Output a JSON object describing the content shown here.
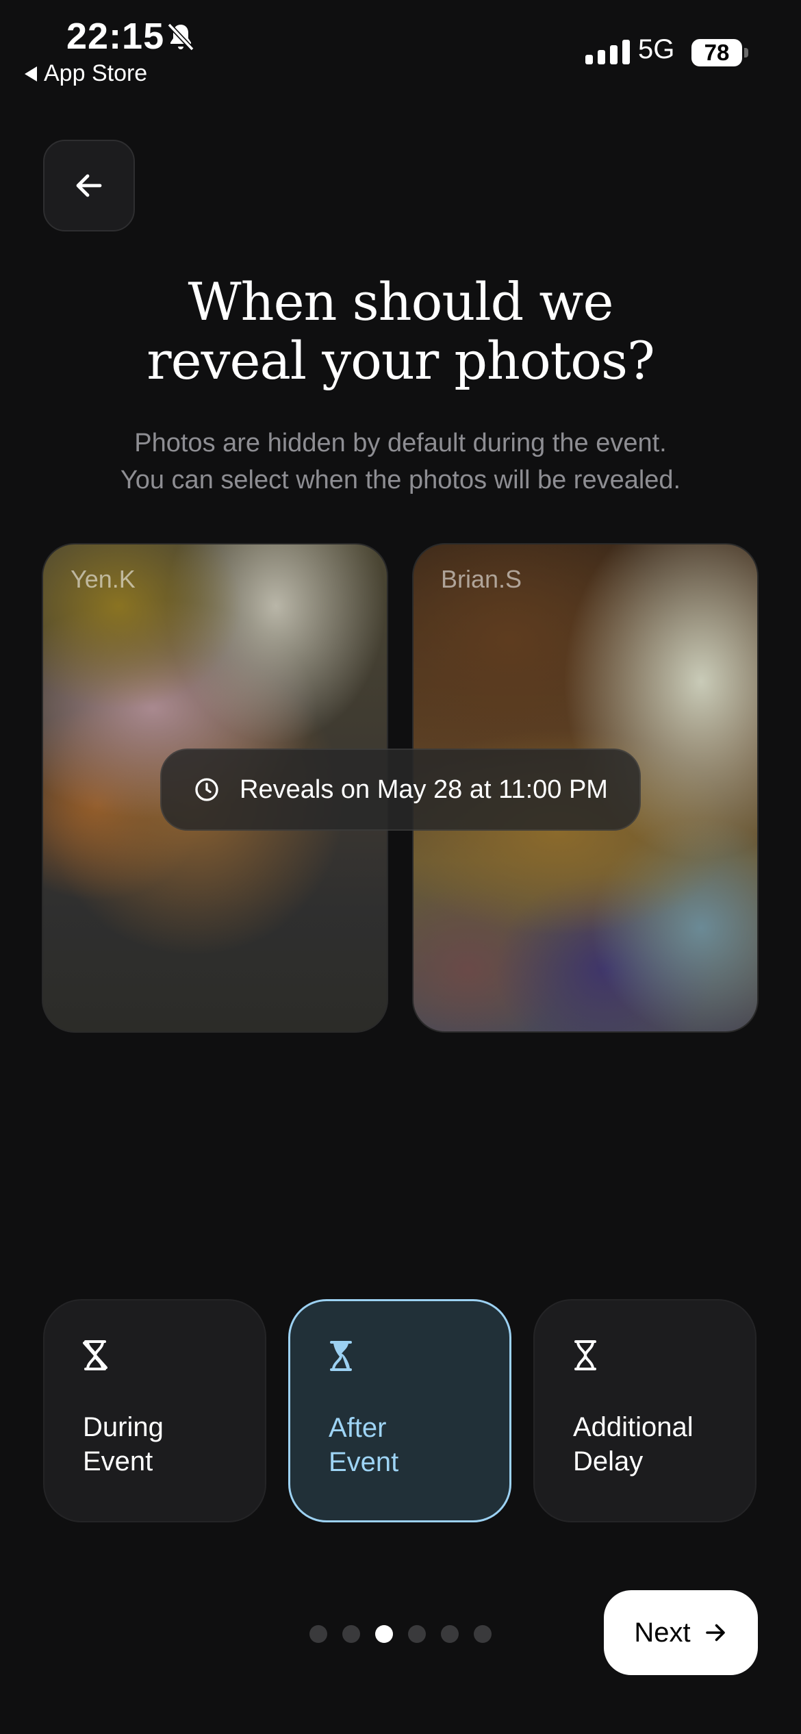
{
  "status_bar": {
    "time": "22:15",
    "back_app_label": "App Store",
    "network": "5G",
    "battery": "78",
    "icons": [
      "bell-slash-icon",
      "cellular-signal-icon",
      "battery-icon"
    ]
  },
  "header": {
    "back_icon": "arrow-left-icon",
    "title_line1": "When should we",
    "title_line2": "reveal your photos?",
    "subtitle_line1": "Photos are hidden by default during the event.",
    "subtitle_line2": "You can select when the photos will be revealed."
  },
  "preview": {
    "cards": [
      {
        "name": "Yen.K"
      },
      {
        "name": "Brian.S"
      }
    ],
    "reveal_icon": "clock-icon",
    "reveal_text": "Reveals on May 28 at 11:00 PM"
  },
  "options": [
    {
      "line1": "During",
      "line2": "Event",
      "icon": "hourglass-crossed-icon",
      "selected": false
    },
    {
      "line1": "After",
      "line2": "Event",
      "icon": "hourglass-icon",
      "selected": true
    },
    {
      "line1": "Additional",
      "line2": "Delay",
      "icon": "hourglass-outline-icon",
      "selected": false
    }
  ],
  "pagination": {
    "count": 6,
    "active_index": 2
  },
  "footer": {
    "next_label": "Next",
    "next_icon": "arrow-right-icon"
  },
  "colors": {
    "background": "#0f0f10",
    "accent": "#9cd1f2",
    "selected_card_bg": "#213038",
    "card_bg": "#1c1c1e"
  }
}
